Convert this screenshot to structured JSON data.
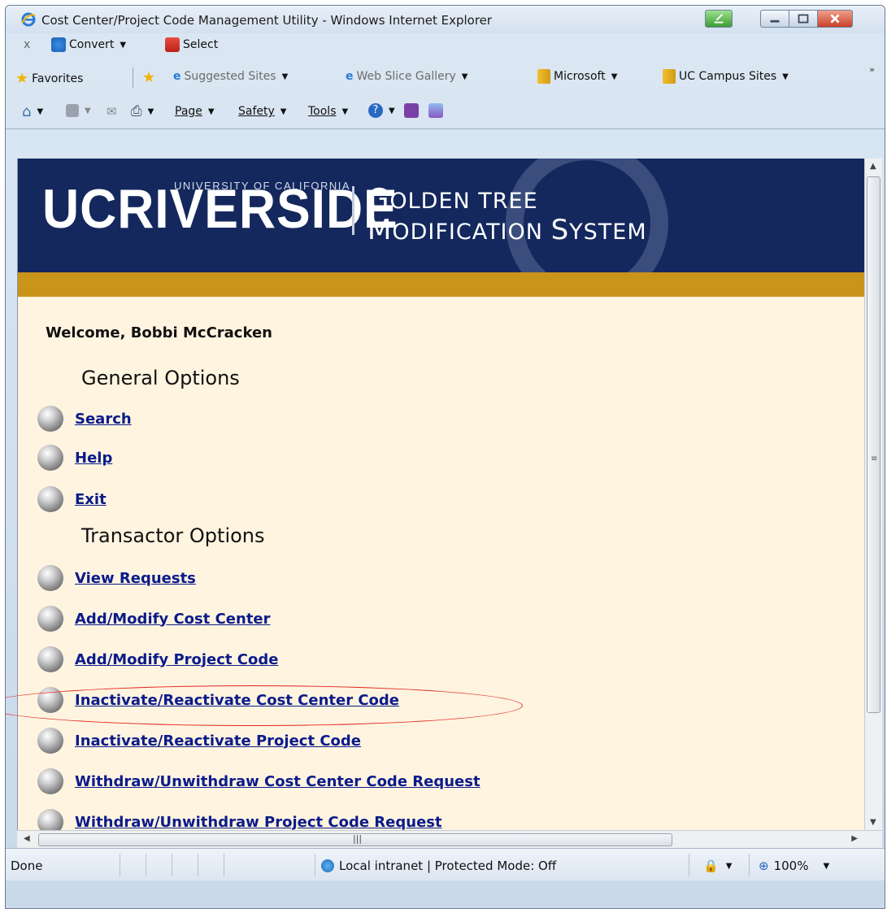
{
  "window": {
    "title": "Cost Center/Project Code Management Utility - Windows Internet Explorer"
  },
  "toolbar1": {
    "close_glyph": "x",
    "convert_label": "Convert",
    "select_label": "Select"
  },
  "favorites_bar": {
    "favorites_label": "Favorites",
    "suggested_sites": "Suggested Sites",
    "web_slice_gallery": "Web Slice Gallery",
    "microsoft": "Microsoft",
    "uc_campus_sites": "UC Campus Sites",
    "overflow": "»"
  },
  "command_bar": {
    "page_label": "Page",
    "safety_label": "Safety",
    "tools_label": "Tools"
  },
  "banner": {
    "uc_riverside": "UCRIVERSIDE",
    "university_of_california": "UNIVERSITY OF CALIFORNIA",
    "golden_tree_first": "G",
    "golden_tree_rest": "OLDEN TREE",
    "modification_first": "M",
    "modification_rest": "ODIFICATION ",
    "system_first": "S",
    "system_rest": "YSTEM"
  },
  "content": {
    "welcome": "Welcome, Bobbi McCracken",
    "general_options_heading": "General Options",
    "general_options": [
      "Search",
      "Help",
      "Exit"
    ],
    "transactor_options_heading": "Transactor Options",
    "transactor_options": [
      "View Requests",
      "Add/Modify Cost Center",
      "Add/Modify Project Code",
      "Inactivate/Reactivate Cost Center Code",
      "Inactivate/Reactivate Project Code",
      "Withdraw/Unwithdraw Cost Center Code Request",
      "Withdraw/Unwithdraw Project Code Request"
    ]
  },
  "statusbar": {
    "status": "Done",
    "zone": "Local intranet | Protected Mode: Off",
    "zoom": "100%"
  },
  "colors": {
    "banner_blue": "#14285e",
    "banner_gold": "#c9941a",
    "page_bg": "#fff4e0",
    "link": "#0b1b8a",
    "annotation": "#e3241c"
  }
}
